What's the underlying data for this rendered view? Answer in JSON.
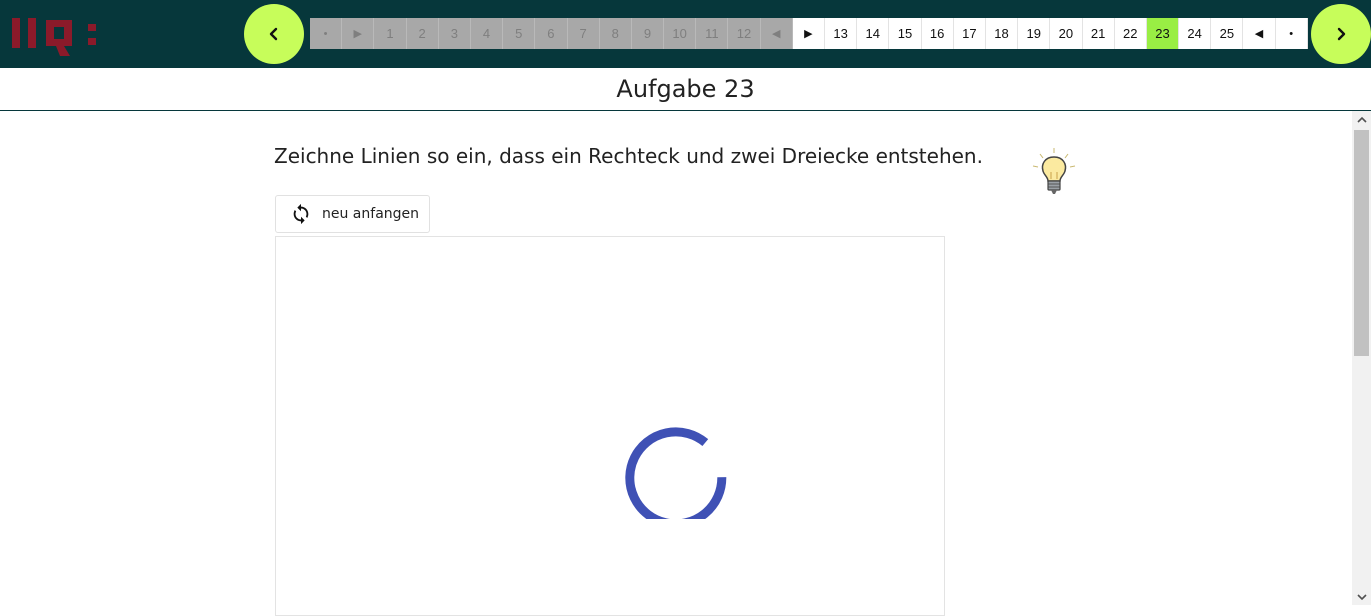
{
  "header": {
    "pager": [
      {
        "label": "•",
        "state": "disabled",
        "icon": "dot-icon"
      },
      {
        "label": "▶",
        "state": "disabled",
        "icon": "play-icon"
      },
      {
        "label": "1",
        "state": "disabled"
      },
      {
        "label": "2",
        "state": "disabled"
      },
      {
        "label": "3",
        "state": "disabled"
      },
      {
        "label": "4",
        "state": "disabled"
      },
      {
        "label": "5",
        "state": "disabled"
      },
      {
        "label": "6",
        "state": "disabled"
      },
      {
        "label": "7",
        "state": "disabled"
      },
      {
        "label": "8",
        "state": "disabled"
      },
      {
        "label": "9",
        "state": "disabled"
      },
      {
        "label": "10",
        "state": "disabled"
      },
      {
        "label": "11",
        "state": "disabled"
      },
      {
        "label": "12",
        "state": "disabled"
      },
      {
        "label": "◀",
        "state": "disabled",
        "icon": "back-triangle-icon"
      },
      {
        "label": "▶",
        "state": "enabled",
        "icon": "play-icon"
      },
      {
        "label": "13",
        "state": "enabled"
      },
      {
        "label": "14",
        "state": "enabled"
      },
      {
        "label": "15",
        "state": "enabled"
      },
      {
        "label": "16",
        "state": "enabled"
      },
      {
        "label": "17",
        "state": "enabled"
      },
      {
        "label": "18",
        "state": "enabled"
      },
      {
        "label": "19",
        "state": "enabled"
      },
      {
        "label": "20",
        "state": "enabled"
      },
      {
        "label": "21",
        "state": "enabled"
      },
      {
        "label": "22",
        "state": "enabled"
      },
      {
        "label": "23",
        "state": "current"
      },
      {
        "label": "24",
        "state": "enabled"
      },
      {
        "label": "25",
        "state": "enabled"
      },
      {
        "label": "◀",
        "state": "enabled",
        "icon": "back-triangle-icon"
      },
      {
        "label": "•",
        "state": "enabled",
        "icon": "dot-icon"
      }
    ]
  },
  "task": {
    "title": "Aufgabe 23",
    "instruction": "Zeichne Linien so ein, dass ein Rechteck und zwei Dreiecke entstehen.",
    "reset_label": "neu anfangen"
  },
  "colors": {
    "header_bg": "#06373b",
    "nav_button": "#c7fd5a",
    "current_page": "#99ee44",
    "spinner": "#3f51b5",
    "logo": "#8b1a2a"
  }
}
